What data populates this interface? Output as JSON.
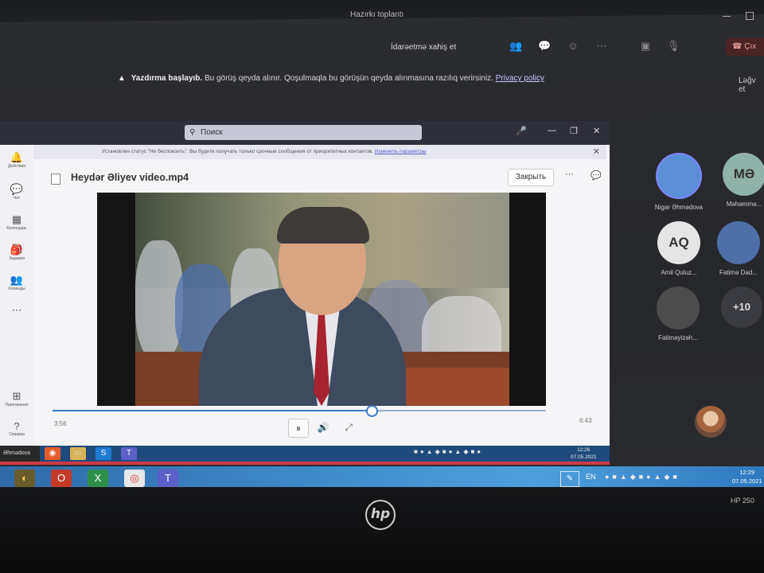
{
  "meeting": {
    "title": "Hazırkı toplantı",
    "control_request": "İdarəetmə xahiş et",
    "leave_label": "Çıx"
  },
  "recording_banner": {
    "heading": "Yazdırma başlayıb.",
    "message": "Bu görüş qeyda alınır. Qoşulmaqla bu görüşün qeyda alınmasına razılıq verirsiniz.",
    "privacy_link": "Privacy policy",
    "dismiss": "Ləğv et"
  },
  "shared_window": {
    "search_placeholder": "Поиск",
    "status_text": "Установлен статус \"Не беспокоить\". Вы будете получать только срочные сообщения от приоритетных контактов.",
    "status_link": "Изменить параметры",
    "file_name": "Heydər Əliyev video.mp4",
    "close_label": "Закрыть",
    "rail": [
      {
        "label": "Действия",
        "icon": "bell-icon"
      },
      {
        "label": "Чат",
        "icon": "chat-icon"
      },
      {
        "label": "Календарь",
        "icon": "calendar-icon"
      },
      {
        "label": "Задания",
        "icon": "assignments-icon"
      },
      {
        "label": "Команды",
        "icon": "teams-icon"
      },
      {
        "label": "Приложения",
        "icon": "apps-icon"
      },
      {
        "label": "Справка",
        "icon": "help-icon"
      }
    ],
    "player": {
      "current_time": "3:56",
      "total_time": "6:43",
      "progress": 0.645
    },
    "taskbar_label": "Əhmədova",
    "clock_time": "12:26",
    "clock_date": "07.05.2021"
  },
  "participants": [
    {
      "initials": "",
      "name": "Nigar Əhmədova",
      "color": "#5a8fd8",
      "photo": true
    },
    {
      "initials": "MƏ",
      "name": "Məhəmmə...",
      "color": "#8fb3a9",
      "photo": false
    },
    {
      "initials": "AQ",
      "name": "Amil Quluz...",
      "color": "#e5e5e5",
      "photo": false
    },
    {
      "initials": "",
      "name": "Fatimə Dad...",
      "color": "#4f6fa8",
      "photo": true
    },
    {
      "initials": "",
      "name": "Fatiməyizəh...",
      "color": "#4c4c4c",
      "photo": true
    },
    {
      "initials": "+10",
      "name": "",
      "color": "#3a3b40",
      "photo": false
    }
  ],
  "taskbar": {
    "language": "EN",
    "clock_time": "12:29",
    "clock_date": "07.05.2021"
  },
  "device": {
    "brand": "hp",
    "model": "HP 250"
  }
}
